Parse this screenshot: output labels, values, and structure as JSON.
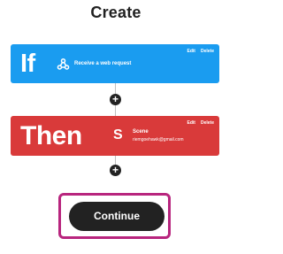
{
  "page": {
    "title": "Create"
  },
  "if_step": {
    "keyword": "If",
    "service_icon": "webhooks-icon",
    "trigger": "Receive a web request",
    "edit_label": "Edit",
    "delete_label": "Delete",
    "color": "#1a9cf0"
  },
  "then_step": {
    "keyword": "Then",
    "service_icon": "scene-s-icon",
    "service_icon_glyph": "S",
    "action": "Scene",
    "account": "riemgoehawk@gmail.com",
    "edit_label": "Edit",
    "delete_label": "Delete",
    "color": "#d93a3a"
  },
  "add_buttons": {
    "glyph": "+"
  },
  "footer": {
    "continue_label": "Continue",
    "highlight_color": "#b8257e"
  }
}
